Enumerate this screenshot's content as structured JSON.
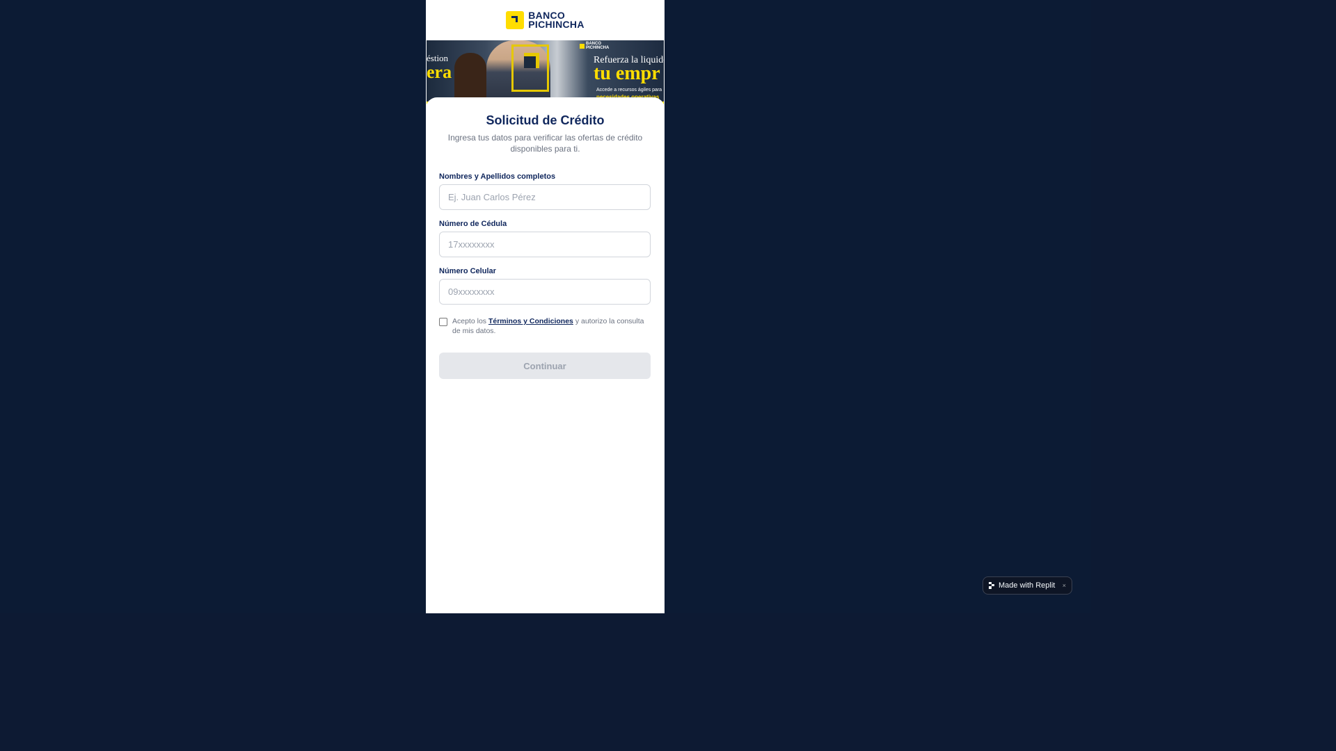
{
  "brand": {
    "line1": "BANCO",
    "line2": "PICHINCHA",
    "mark_color": "#ffdd00",
    "navy": "#0f265c"
  },
  "banner": {
    "left_top": "éstion",
    "left_big": "era",
    "right_top": "Refuerza la liquidez",
    "right_big": "tu empr",
    "right_small": "Accede a recursos ágiles para",
    "right_yellow": "necesidades operativas",
    "mini_brand_1": "BANCO",
    "mini_brand_2": "PICHINCHA"
  },
  "form": {
    "title": "Solicitud de Crédito",
    "subtitle": "Ingresa tus datos para verificar las ofertas de crédito disponibles para ti.",
    "name_label": "Nombres y Apellidos completos",
    "name_placeholder": "Ej. Juan Carlos Pérez",
    "name_value": "",
    "cedula_label": "Número de Cédula",
    "cedula_placeholder": "17xxxxxxxx",
    "cedula_value": "",
    "phone_label": "Número Celular",
    "phone_placeholder": "09xxxxxxxx",
    "phone_value": "",
    "terms_prefix": "Acepto los ",
    "terms_link": "Términos y Condiciones",
    "terms_suffix": " y autorizo la consulta de mis datos.",
    "terms_checked": false,
    "continue_label": "Continuar"
  },
  "replit": {
    "label": "Made with Replit",
    "close": "×"
  }
}
